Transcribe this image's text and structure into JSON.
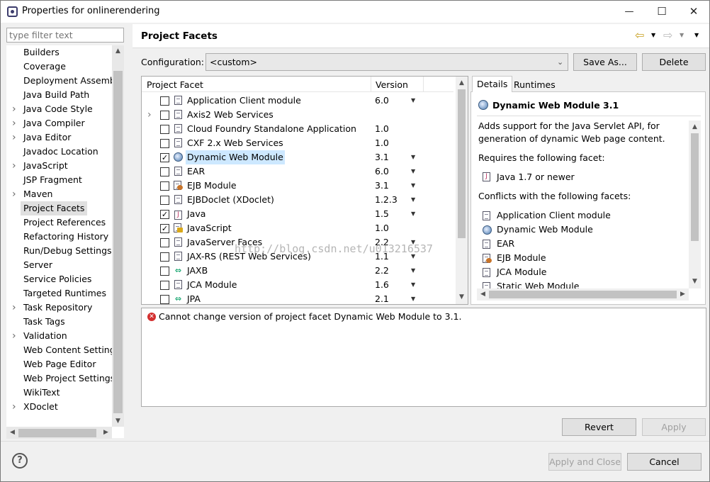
{
  "window": {
    "title": "Properties for onlinerendering",
    "minimize": "—",
    "maximize": "☐",
    "close": "✕"
  },
  "filter": {
    "placeholder": "type filter text"
  },
  "nav": {
    "items": [
      {
        "label": "Builders",
        "expandable": false
      },
      {
        "label": "Coverage",
        "expandable": false
      },
      {
        "label": "Deployment Assembly",
        "expandable": false
      },
      {
        "label": "Java Build Path",
        "expandable": false
      },
      {
        "label": "Java Code Style",
        "expandable": true
      },
      {
        "label": "Java Compiler",
        "expandable": true
      },
      {
        "label": "Java Editor",
        "expandable": true
      },
      {
        "label": "Javadoc Location",
        "expandable": false
      },
      {
        "label": "JavaScript",
        "expandable": true
      },
      {
        "label": "JSP Fragment",
        "expandable": false
      },
      {
        "label": "Maven",
        "expandable": true
      },
      {
        "label": "Project Facets",
        "expandable": false,
        "selected": true
      },
      {
        "label": "Project References",
        "expandable": false
      },
      {
        "label": "Refactoring History",
        "expandable": false
      },
      {
        "label": "Run/Debug Settings",
        "expandable": false
      },
      {
        "label": "Server",
        "expandable": false
      },
      {
        "label": "Service Policies",
        "expandable": false
      },
      {
        "label": "Targeted Runtimes",
        "expandable": false
      },
      {
        "label": "Task Repository",
        "expandable": true
      },
      {
        "label": "Task Tags",
        "expandable": false
      },
      {
        "label": "Validation",
        "expandable": true
      },
      {
        "label": "Web Content Settings",
        "expandable": false
      },
      {
        "label": "Web Page Editor",
        "expandable": false
      },
      {
        "label": "Web Project Settings",
        "expandable": false
      },
      {
        "label": "WikiText",
        "expandable": false
      },
      {
        "label": "XDoclet",
        "expandable": true
      }
    ]
  },
  "page": {
    "title": "Project Facets",
    "config_label": "Configuration:",
    "config_value": "<custom>",
    "save_as": "Save As...",
    "delete": "Delete"
  },
  "facets": {
    "col_facet": "Project Facet",
    "col_version": "Version",
    "rows": [
      {
        "name": "Application Client module",
        "version": "6.0",
        "checked": false,
        "dropdown": true,
        "expand": false,
        "icon": "page"
      },
      {
        "name": "Axis2 Web Services",
        "version": "",
        "checked": false,
        "dropdown": false,
        "expand": true,
        "icon": "page"
      },
      {
        "name": "Cloud Foundry Standalone Application",
        "version": "1.0",
        "checked": false,
        "dropdown": false,
        "expand": false,
        "icon": "page"
      },
      {
        "name": "CXF 2.x Web Services",
        "version": "1.0",
        "checked": false,
        "dropdown": false,
        "expand": false,
        "icon": "page"
      },
      {
        "name": "Dynamic Web Module",
        "version": "3.1",
        "checked": true,
        "dropdown": true,
        "expand": false,
        "icon": "globe",
        "highlight": true
      },
      {
        "name": "EAR",
        "version": "6.0",
        "checked": false,
        "dropdown": true,
        "expand": false,
        "icon": "page"
      },
      {
        "name": "EJB Module",
        "version": "3.1",
        "checked": false,
        "dropdown": true,
        "expand": false,
        "icon": "bean"
      },
      {
        "name": "EJBDoclet (XDoclet)",
        "version": "1.2.3",
        "checked": false,
        "dropdown": true,
        "expand": false,
        "icon": "page"
      },
      {
        "name": "Java",
        "version": "1.5",
        "checked": true,
        "dropdown": true,
        "expand": false,
        "icon": "java"
      },
      {
        "name": "JavaScript",
        "version": "1.0",
        "checked": true,
        "dropdown": false,
        "expand": false,
        "icon": "lock"
      },
      {
        "name": "JavaServer Faces",
        "version": "2.2",
        "checked": false,
        "dropdown": true,
        "expand": false,
        "icon": "page"
      },
      {
        "name": "JAX-RS (REST Web Services)",
        "version": "1.1",
        "checked": false,
        "dropdown": true,
        "expand": false,
        "icon": "page"
      },
      {
        "name": "JAXB",
        "version": "2.2",
        "checked": false,
        "dropdown": true,
        "expand": false,
        "icon": "arrows"
      },
      {
        "name": "JCA Module",
        "version": "1.6",
        "checked": false,
        "dropdown": true,
        "expand": false,
        "icon": "page"
      },
      {
        "name": "JPA",
        "version": "2.1",
        "checked": false,
        "dropdown": true,
        "expand": false,
        "icon": "arrows"
      }
    ]
  },
  "details": {
    "tab_details": "Details",
    "tab_runtimes": "Runtimes",
    "heading": "Dynamic Web Module 3.1",
    "desc1": "Adds support for the Java Servlet API, for",
    "desc2": "generation of dynamic Web page content.",
    "requires": "Requires the following facet:",
    "req_item": "Java 1.7 or newer",
    "conflicts": "Conflicts with the following facets:",
    "conflict_items": [
      "Application Client module",
      "Dynamic Web Module",
      "EAR",
      "EJB Module",
      "JCA Module",
      "Static Web Module"
    ]
  },
  "message": {
    "text": "Cannot change version of project facet Dynamic Web Module to 3.1."
  },
  "watermark": "http://blog.csdn.net/u013216537",
  "buttons": {
    "revert": "Revert",
    "apply": "Apply",
    "apply_close": "Apply and Close",
    "cancel": "Cancel",
    "help": "?"
  },
  "colors": {
    "selection": "#cde8ff",
    "error": "#d32f2f"
  }
}
